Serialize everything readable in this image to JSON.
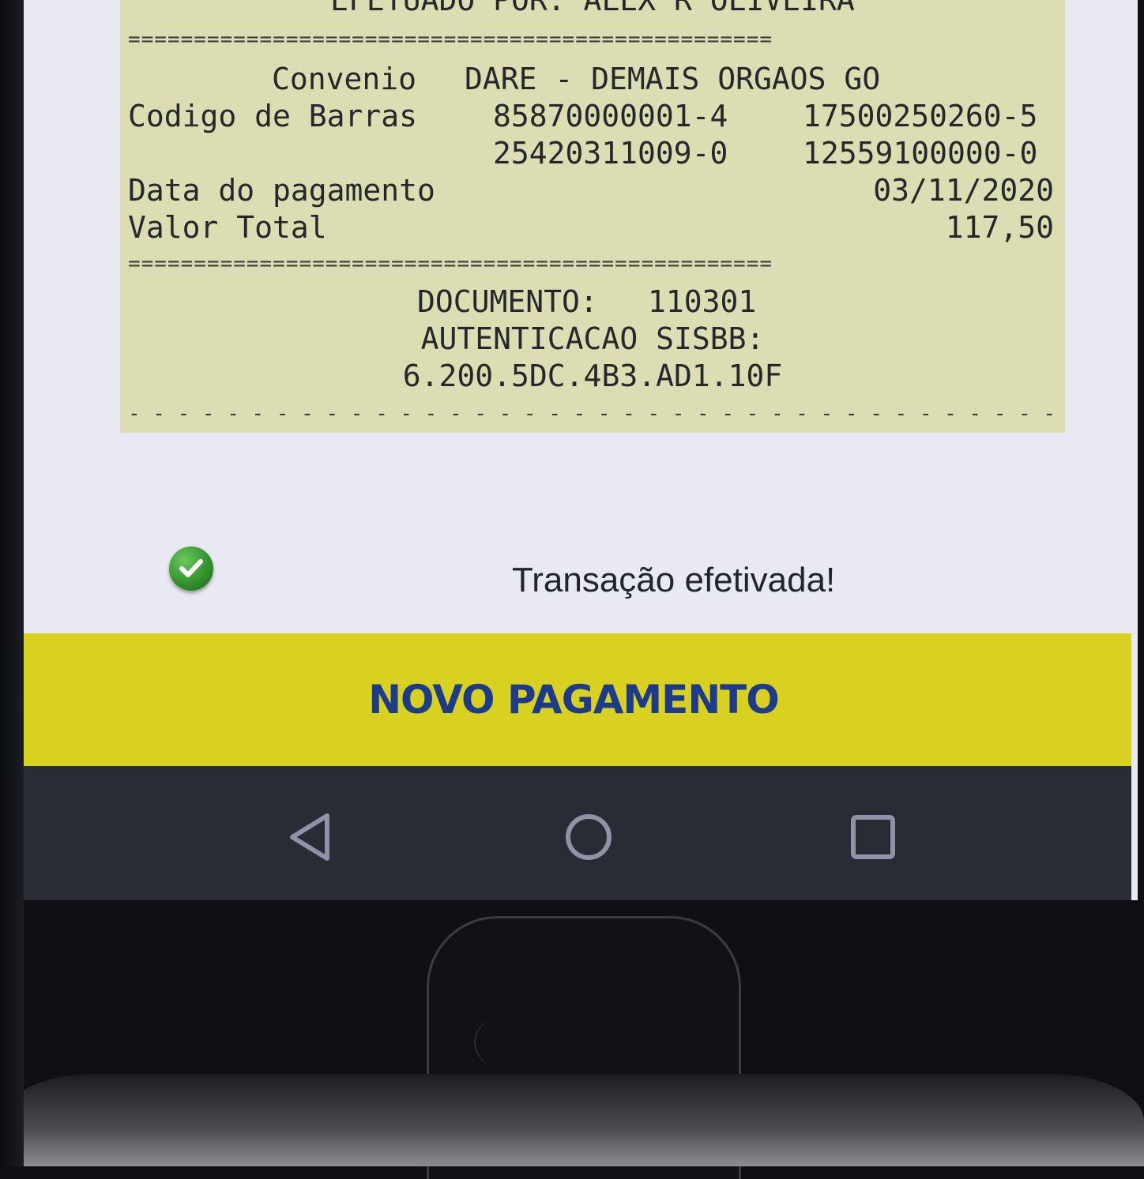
{
  "receipt": {
    "top_line": "EFETUADO POR: ALEX R OLIVEIRA",
    "separator_eq": "=================================================",
    "convenio_label": "Convenio",
    "convenio_value": "DARE - DEMAIS ORGAOS GO",
    "barcode_label": "Codigo de Barras",
    "barcode_1": "85870000001-4",
    "barcode_2": "17500250260-5",
    "barcode_3": "25420311009-0",
    "barcode_4": "12559100000-0",
    "payment_date_label": "Data do pagamento",
    "payment_date_value": "03/11/2020",
    "total_label": "Valor Total",
    "total_value": "117,50",
    "document_label": "DOCUMENTO:",
    "document_value": "110301",
    "auth_label": "AUTENTICACAO SISBB:",
    "auth_value": "6.200.5DC.4B3.AD1.10F",
    "separator_dash": "- - - - - - - - - - - - - - - - - - - - - - - - - - - - - - - - - - - - - - - - - - - - - - - - -"
  },
  "status": {
    "icon": "check-circle-icon",
    "message": "Transação efetivada!",
    "color": "#2f8f2b"
  },
  "action": {
    "new_payment_label": "NOVO PAGAMENTO",
    "button_color": "#d8d120",
    "text_color": "#1d3b8c"
  },
  "navbar": {
    "back_icon": "back-triangle-icon",
    "home_icon": "home-circle-icon",
    "recents_icon": "recents-square-icon"
  }
}
